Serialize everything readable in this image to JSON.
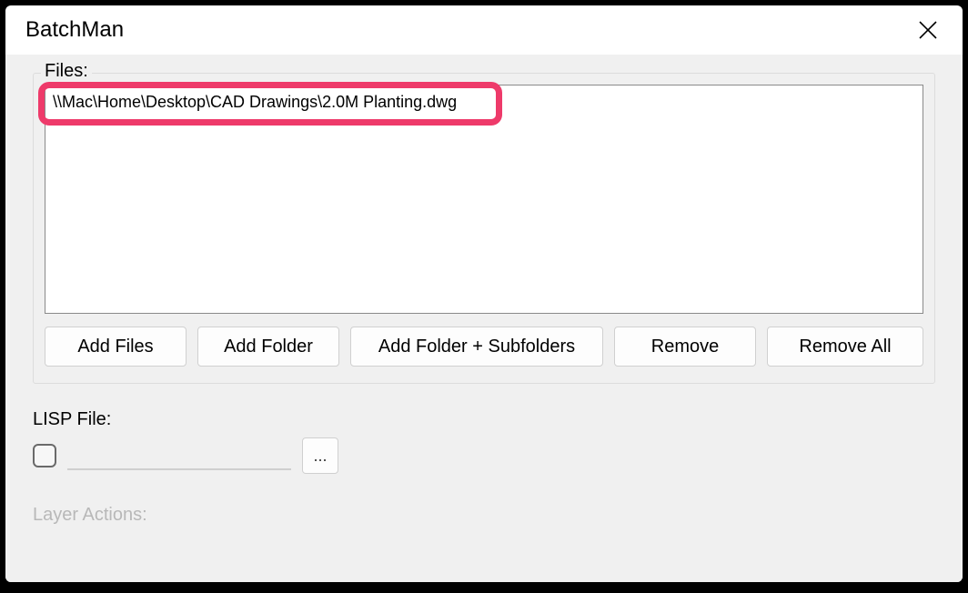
{
  "window": {
    "title": "BatchMan"
  },
  "files": {
    "label": "Files:",
    "items": [
      "\\\\Mac\\Home\\Desktop\\CAD Drawings\\2.0M Planting.dwg"
    ],
    "buttons": {
      "add_files": "Add Files",
      "add_folder": "Add Folder",
      "add_subfolders": "Add Folder + Subfolders",
      "remove": "Remove",
      "remove_all": "Remove All"
    }
  },
  "lisp": {
    "label": "LISP File:",
    "value": "",
    "browse": "..."
  },
  "layer_actions": {
    "label": "Layer Actions:"
  }
}
